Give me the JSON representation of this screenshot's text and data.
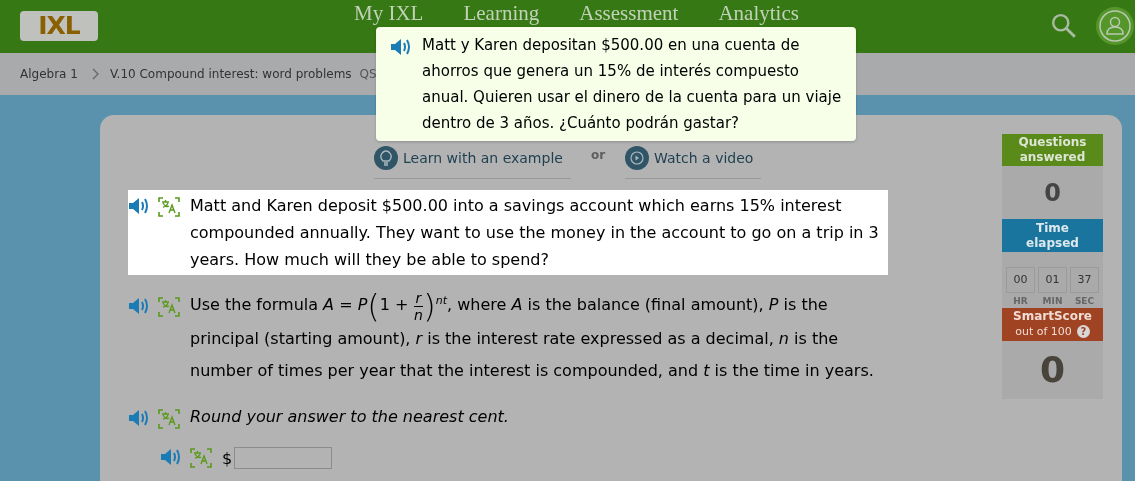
{
  "header": {
    "logo": "IXL",
    "nav": [
      "My IXL",
      "Learning",
      "Assessment",
      "Analytics"
    ]
  },
  "breadcrumb": [
    "Algebra 1",
    "V.10 Compound interest: word problems",
    "QS"
  ],
  "tooltip": {
    "text": "Matt y Karen depositan $500.00 en una cuenta de ahorros que genera un 15% de interés compuesto anual. Quieren usar el dinero de la cuenta para un viaje dentro de 3 años. ¿Cuánto podrán gastar?"
  },
  "help": {
    "example": "Learn with an example",
    "separator": "or",
    "video": "Watch a video"
  },
  "question": {
    "text": "Matt and Karen deposit $500.00 into a savings account which earns 15% interest compounded annually. They want to use the money in the account to go on a trip in 3 years. How much will they be able to spend?"
  },
  "formula": {
    "intro": "Use the formula",
    "lhs": "A",
    "equals": "=",
    "p": "P",
    "open_paren": "(",
    "one": "1",
    "plus": "+",
    "numerator": "r",
    "denominator": "n",
    "close_paren": ")",
    "exponent": "nt",
    "rest": ", where *A* is the balance (final amount), *P* is the principal (starting amount), *r* is the interest rate expressed as a decimal, *n* is the number of times per year that the interest is compounded, and *t* is the time in years."
  },
  "instruction": "Round your answer to the nearest cent.",
  "answer": {
    "prefix": "$"
  },
  "sidebar": {
    "questions_label": "Questions answered",
    "questions_value": "0",
    "time_label": "Time elapsed",
    "time": [
      {
        "value": "00",
        "unit": "HR"
      },
      {
        "value": "01",
        "unit": "MIN"
      },
      {
        "value": "37",
        "unit": "SEC"
      }
    ],
    "score_label": "SmartScore",
    "score_sub": "out of 100",
    "help_mark": "?",
    "score_value": "0"
  }
}
